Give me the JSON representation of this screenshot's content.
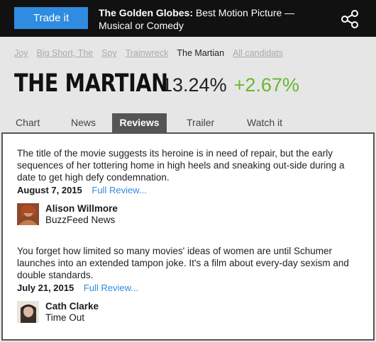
{
  "topbar": {
    "trade_label": "Trade it",
    "headline_bold": "The Golden Globes:",
    "headline_rest": " Best Motion Picture — Musical or Comedy",
    "share_icon": "share-icon"
  },
  "breadcrumbs": [
    "Joy",
    "Big Short, The",
    "Spy",
    "Trainwreck",
    "The Martian",
    "All candidats"
  ],
  "breadcrumb_active_index": 4,
  "movie": {
    "title": "THE MARTIAN",
    "percent": "13.24%",
    "change": "+2.67%",
    "change_color": "#6ab531"
  },
  "tabs": [
    "Chart",
    "News",
    "Reviews",
    "Trailer",
    "Watch it"
  ],
  "active_tab": "Reviews",
  "reviews": [
    {
      "quote": "The title of the movie suggests its heroine is in need of repair, but the early sequences of her tottering home in high heels and sneaking out-side during a date to get high defy condemnation.",
      "date": "August 7, 2015",
      "link": "Full Review...",
      "author": "Alison Willmore",
      "outlet": "BuzzFeed News"
    },
    {
      "quote": "You forget how limited so many movies' ideas of women are until Schumer launches into an extended tampon joke. It's a film about every-day sexism and double standards.",
      "date": "July 21, 2015",
      "link": "Full Review...",
      "author": "Cath Clarke",
      "outlet": "Time Out"
    }
  ],
  "colors": {
    "accent": "#2f8ce0",
    "topbar": "#111111",
    "tab_active": "#555555"
  }
}
